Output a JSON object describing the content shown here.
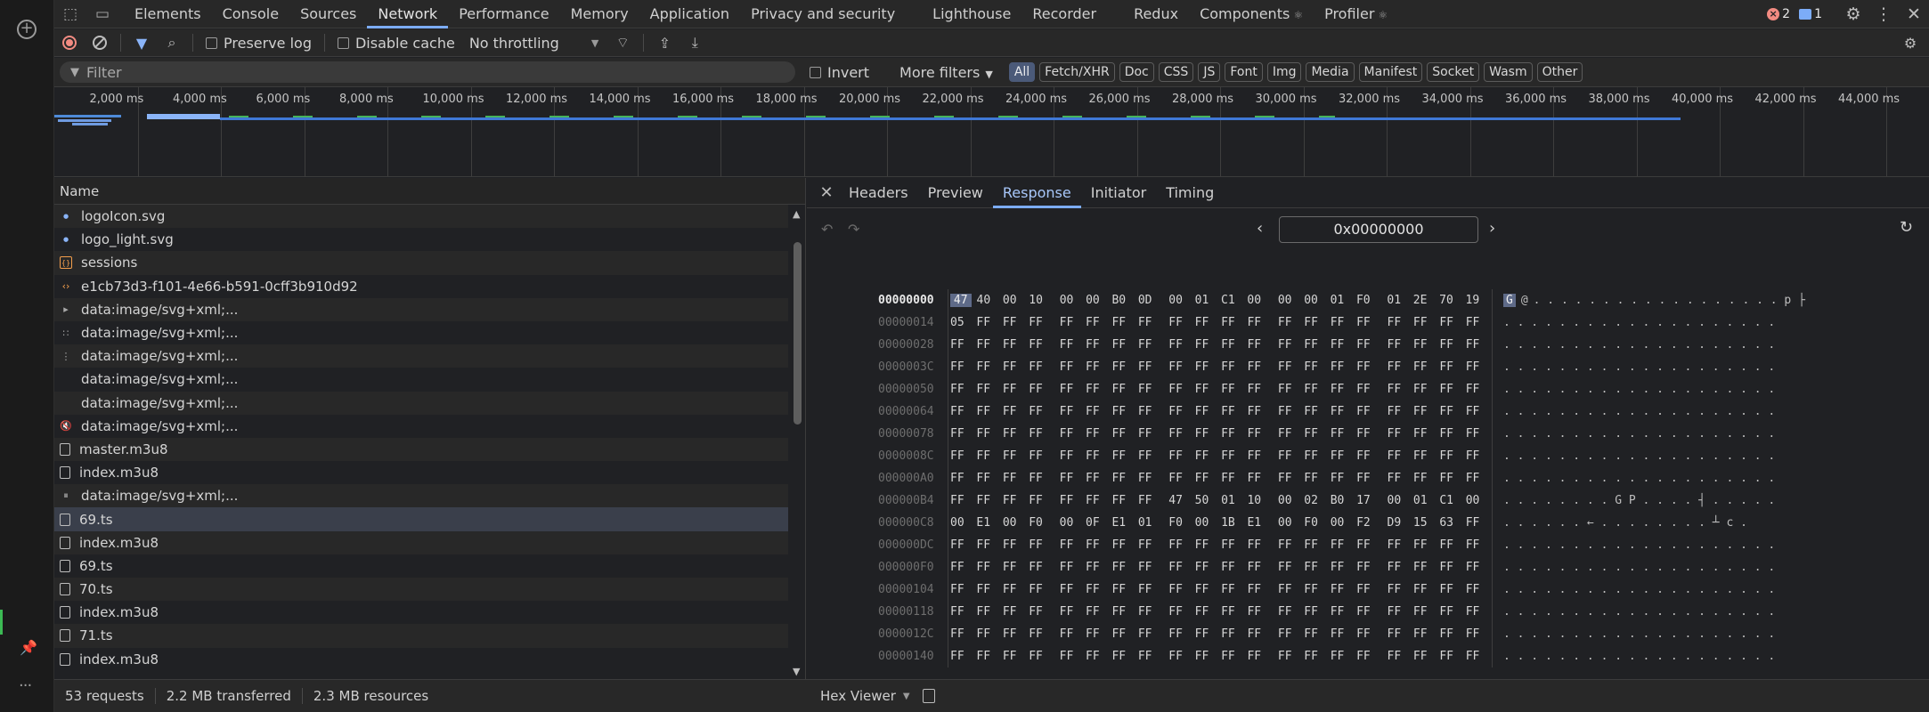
{
  "topbar": {
    "tabs": [
      {
        "label": "Elements"
      },
      {
        "label": "Console"
      },
      {
        "label": "Sources"
      },
      {
        "label": "Network",
        "active": true
      },
      {
        "label": "Performance"
      },
      {
        "label": "Memory"
      },
      {
        "label": "Application"
      },
      {
        "label": "Privacy and security"
      },
      {
        "label": "Lighthouse"
      },
      {
        "label": "Recorder"
      },
      {
        "label": "Redux"
      },
      {
        "label": "Components"
      },
      {
        "label": "Profiler"
      }
    ],
    "error_count": "2",
    "info_count": "1"
  },
  "toolbar": {
    "preserve_log": "Preserve log",
    "disable_cache": "Disable cache",
    "throttling": "No throttling"
  },
  "filterbar": {
    "placeholder": "Filter",
    "invert": "Invert",
    "more_filters": "More filters",
    "chips": [
      "All",
      "Fetch/XHR",
      "Doc",
      "CSS",
      "JS",
      "Font",
      "Img",
      "Media",
      "Manifest",
      "Socket",
      "Wasm",
      "Other"
    ]
  },
  "overview": {
    "labels": [
      "2,000 ms",
      "4,000 ms",
      "6,000 ms",
      "8,000 ms",
      "10,000 ms",
      "12,000 ms",
      "14,000 ms",
      "16,000 ms",
      "18,000 ms",
      "20,000 ms",
      "22,000 ms",
      "24,000 ms",
      "26,000 ms",
      "28,000 ms",
      "30,000 ms",
      "32,000 ms",
      "34,000 ms",
      "36,000 ms",
      "38,000 ms",
      "40,000 ms",
      "42,000 ms",
      "44,000 ms"
    ]
  },
  "requests": {
    "column_name": "Name",
    "rows": [
      {
        "name": "logoIcon.svg",
        "icon": "svg"
      },
      {
        "name": "logo_light.svg",
        "icon": "svg"
      },
      {
        "name": "sessions",
        "icon": "session"
      },
      {
        "name": "e1cb73d3-f101-4e66-b591-0cff3b910d92",
        "icon": "xhr"
      },
      {
        "name": "data:image/svg+xml;...",
        "icon": "play"
      },
      {
        "name": "data:image/svg+xml;...",
        "icon": "grid"
      },
      {
        "name": "data:image/svg+xml;...",
        "icon": "dots"
      },
      {
        "name": "data:image/svg+xml;...",
        "icon": "none"
      },
      {
        "name": "data:image/svg+xml;...",
        "icon": "none"
      },
      {
        "name": "data:image/svg+xml;...",
        "icon": "mute"
      },
      {
        "name": "master.m3u8",
        "icon": "doc"
      },
      {
        "name": "index.m3u8",
        "icon": "doc"
      },
      {
        "name": "data:image/svg+xml;...",
        "icon": "pause"
      },
      {
        "name": "69.ts",
        "icon": "doc",
        "selected": true
      },
      {
        "name": "index.m3u8",
        "icon": "doc"
      },
      {
        "name": "69.ts",
        "icon": "doc"
      },
      {
        "name": "70.ts",
        "icon": "doc"
      },
      {
        "name": "index.m3u8",
        "icon": "doc"
      },
      {
        "name": "71.ts",
        "icon": "doc"
      },
      {
        "name": "index.m3u8",
        "icon": "doc"
      }
    ]
  },
  "detail": {
    "tabs": [
      {
        "label": "Headers"
      },
      {
        "label": "Preview"
      },
      {
        "label": "Response",
        "active": true
      },
      {
        "label": "Initiator"
      },
      {
        "label": "Timing"
      }
    ],
    "offset": "0x00000000"
  },
  "hex": {
    "rows": [
      {
        "offset": "00000000",
        "bytes": [
          "47",
          "40",
          "00",
          "10",
          "00",
          "00",
          "B0",
          "0D",
          "00",
          "01",
          "C1",
          "00",
          "00",
          "00",
          "01",
          "F0",
          "01",
          "2E",
          "70",
          "19"
        ],
        "ascii": ". . . . . . . . . . . . . . . . . . p ├",
        "first_ascii": "G",
        "second_ascii": "@"
      },
      {
        "offset": "00000014",
        "bytes": [
          "05",
          "FF",
          "FF",
          "FF",
          "FF",
          "FF",
          "FF",
          "FF",
          "FF",
          "FF",
          "FF",
          "FF",
          "FF",
          "FF",
          "FF",
          "FF",
          "FF",
          "FF",
          "FF",
          "FF"
        ],
        "ascii": ". . . . . . . . . . . . . . . . . . . ."
      },
      {
        "offset": "00000028",
        "bytes": [
          "FF",
          "FF",
          "FF",
          "FF",
          "FF",
          "FF",
          "FF",
          "FF",
          "FF",
          "FF",
          "FF",
          "FF",
          "FF",
          "FF",
          "FF",
          "FF",
          "FF",
          "FF",
          "FF",
          "FF"
        ],
        "ascii": ". . . . . . . . . . . . . . . . . . . ."
      },
      {
        "offset": "0000003C",
        "bytes": [
          "FF",
          "FF",
          "FF",
          "FF",
          "FF",
          "FF",
          "FF",
          "FF",
          "FF",
          "FF",
          "FF",
          "FF",
          "FF",
          "FF",
          "FF",
          "FF",
          "FF",
          "FF",
          "FF",
          "FF"
        ],
        "ascii": ". . . . . . . . . . . . . . . . . . . ."
      },
      {
        "offset": "00000050",
        "bytes": [
          "FF",
          "FF",
          "FF",
          "FF",
          "FF",
          "FF",
          "FF",
          "FF",
          "FF",
          "FF",
          "FF",
          "FF",
          "FF",
          "FF",
          "FF",
          "FF",
          "FF",
          "FF",
          "FF",
          "FF"
        ],
        "ascii": ". . . . . . . . . . . . . . . . . . . ."
      },
      {
        "offset": "00000064",
        "bytes": [
          "FF",
          "FF",
          "FF",
          "FF",
          "FF",
          "FF",
          "FF",
          "FF",
          "FF",
          "FF",
          "FF",
          "FF",
          "FF",
          "FF",
          "FF",
          "FF",
          "FF",
          "FF",
          "FF",
          "FF"
        ],
        "ascii": ". . . . . . . . . . . . . . . . . . . ."
      },
      {
        "offset": "00000078",
        "bytes": [
          "FF",
          "FF",
          "FF",
          "FF",
          "FF",
          "FF",
          "FF",
          "FF",
          "FF",
          "FF",
          "FF",
          "FF",
          "FF",
          "FF",
          "FF",
          "FF",
          "FF",
          "FF",
          "FF",
          "FF"
        ],
        "ascii": ". . . . . . . . . . . . . . . . . . . ."
      },
      {
        "offset": "0000008C",
        "bytes": [
          "FF",
          "FF",
          "FF",
          "FF",
          "FF",
          "FF",
          "FF",
          "FF",
          "FF",
          "FF",
          "FF",
          "FF",
          "FF",
          "FF",
          "FF",
          "FF",
          "FF",
          "FF",
          "FF",
          "FF"
        ],
        "ascii": ". . . . . . . . . . . . . . . . . . . ."
      },
      {
        "offset": "000000A0",
        "bytes": [
          "FF",
          "FF",
          "FF",
          "FF",
          "FF",
          "FF",
          "FF",
          "FF",
          "FF",
          "FF",
          "FF",
          "FF",
          "FF",
          "FF",
          "FF",
          "FF",
          "FF",
          "FF",
          "FF",
          "FF"
        ],
        "ascii": ". . . . . . . . . . . . . . . . . . . ."
      },
      {
        "offset": "000000B4",
        "bytes": [
          "FF",
          "FF",
          "FF",
          "FF",
          "FF",
          "FF",
          "FF",
          "FF",
          "47",
          "50",
          "01",
          "10",
          "00",
          "02",
          "B0",
          "17",
          "00",
          "01",
          "C1",
          "00"
        ],
        "ascii": ". . . . . . . . G P . . . . ┤ . . . . ."
      },
      {
        "offset": "000000C8",
        "bytes": [
          "00",
          "E1",
          "00",
          "F0",
          "00",
          "0F",
          "E1",
          "01",
          "F0",
          "00",
          "1B",
          "E1",
          "00",
          "F0",
          "00",
          "F2",
          "D9",
          "15",
          "63",
          "FF"
        ],
        "ascii": ". . . . . . ← . . . . . . . . ┴ c ."
      },
      {
        "offset": "000000DC",
        "bytes": [
          "FF",
          "FF",
          "FF",
          "FF",
          "FF",
          "FF",
          "FF",
          "FF",
          "FF",
          "FF",
          "FF",
          "FF",
          "FF",
          "FF",
          "FF",
          "FF",
          "FF",
          "FF",
          "FF",
          "FF"
        ],
        "ascii": ". . . . . . . . . . . . . . . . . . . ."
      },
      {
        "offset": "000000F0",
        "bytes": [
          "FF",
          "FF",
          "FF",
          "FF",
          "FF",
          "FF",
          "FF",
          "FF",
          "FF",
          "FF",
          "FF",
          "FF",
          "FF",
          "FF",
          "FF",
          "FF",
          "FF",
          "FF",
          "FF",
          "FF"
        ],
        "ascii": ". . . . . . . . . . . . . . . . . . . ."
      },
      {
        "offset": "00000104",
        "bytes": [
          "FF",
          "FF",
          "FF",
          "FF",
          "FF",
          "FF",
          "FF",
          "FF",
          "FF",
          "FF",
          "FF",
          "FF",
          "FF",
          "FF",
          "FF",
          "FF",
          "FF",
          "FF",
          "FF",
          "FF"
        ],
        "ascii": ". . . . . . . . . . . . . . . . . . . ."
      },
      {
        "offset": "00000118",
        "bytes": [
          "FF",
          "FF",
          "FF",
          "FF",
          "FF",
          "FF",
          "FF",
          "FF",
          "FF",
          "FF",
          "FF",
          "FF",
          "FF",
          "FF",
          "FF",
          "FF",
          "FF",
          "FF",
          "FF",
          "FF"
        ],
        "ascii": ". . . . . . . . . . . . . . . . . . . ."
      },
      {
        "offset": "0000012C",
        "bytes": [
          "FF",
          "FF",
          "FF",
          "FF",
          "FF",
          "FF",
          "FF",
          "FF",
          "FF",
          "FF",
          "FF",
          "FF",
          "FF",
          "FF",
          "FF",
          "FF",
          "FF",
          "FF",
          "FF",
          "FF"
        ],
        "ascii": ". . . . . . . . . . . . . . . . . . . ."
      },
      {
        "offset": "00000140",
        "bytes": [
          "FF",
          "FF",
          "FF",
          "FF",
          "FF",
          "FF",
          "FF",
          "FF",
          "FF",
          "FF",
          "FF",
          "FF",
          "FF",
          "FF",
          "FF",
          "FF",
          "FF",
          "FF",
          "FF",
          "FF"
        ],
        "ascii": ". . . . . . . . . . . . . . . . . . . ."
      }
    ]
  },
  "status": {
    "requests": "53 requests",
    "transferred": "2.2 MB transferred",
    "resources": "2.3 MB resources",
    "viewer": "Hex Viewer"
  }
}
